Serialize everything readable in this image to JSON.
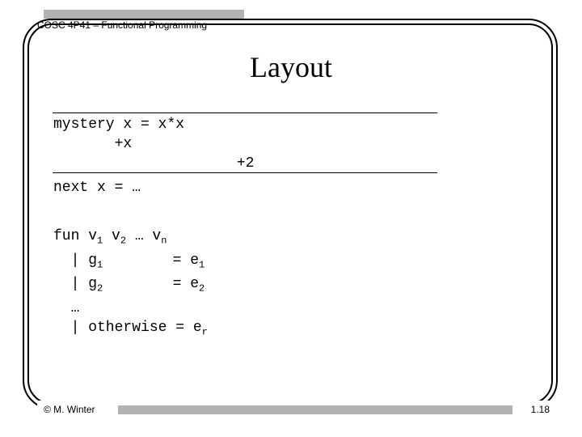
{
  "header": {
    "course": "COSC 4P41 – Functional Programming"
  },
  "title": "Layout",
  "code_block_1": {
    "l1": "mystery x = x*x",
    "l2": "       +x",
    "l3": "                     +2"
  },
  "code_block_1b": "next x = …",
  "code_block_2": {
    "l1": "fun v",
    "l1a": "1",
    "l1b": " v",
    "l1c": "2",
    "l1d": " … v",
    "l1e": "n",
    "l2": "  | g",
    "l2a": "1",
    "l2b": "        = e",
    "l2c": "1",
    "l3": "  | g",
    "l3a": "2",
    "l3b": "        = e",
    "l3c": "2",
    "l4": "  …",
    "l5": "  | otherwise = e",
    "l5a": "r"
  },
  "footer": {
    "author": "© M. Winter",
    "page": "1.18"
  }
}
